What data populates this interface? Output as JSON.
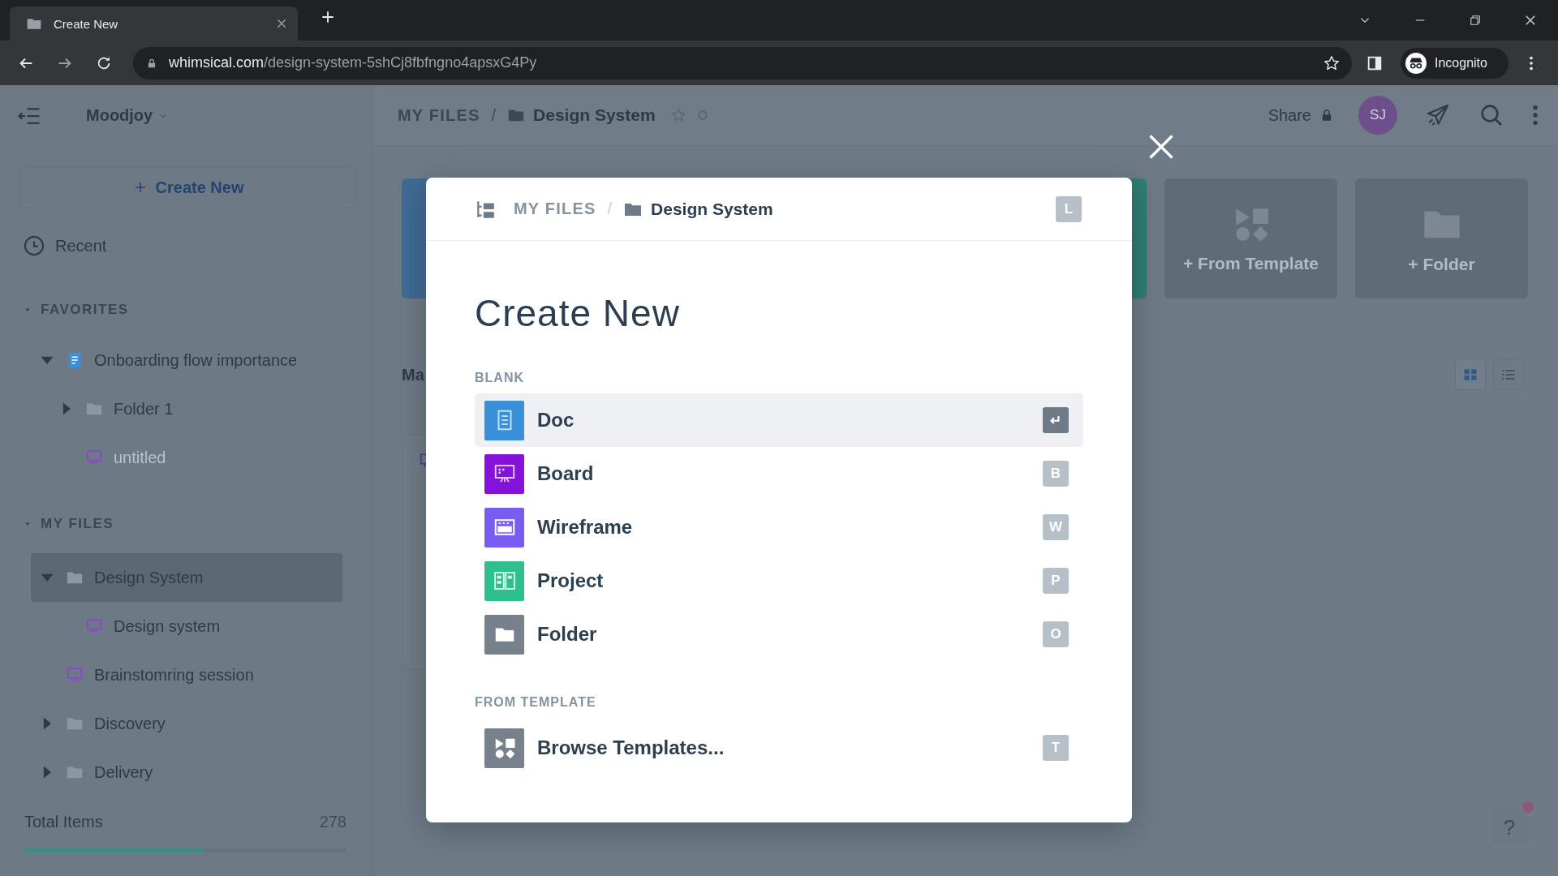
{
  "browser": {
    "tab_title": "Create New",
    "url_host": "whimsical.com",
    "url_path": "/design-system-5shCj8fbfngno4apsxG4Py",
    "profile_label": "Incognito"
  },
  "sidebar": {
    "workspace": "Moodjoy",
    "create_label": "Create New",
    "recent_label": "Recent",
    "sections": [
      {
        "title": "FAVORITES",
        "expanded": true,
        "items": [
          {
            "kind": "doc",
            "label": "Onboarding flow importance",
            "expandable": true,
            "expanded": true,
            "selected": false,
            "muted": false,
            "children": [
              {
                "kind": "folder",
                "label": "Folder 1",
                "expandable": true,
                "expanded": false,
                "selected": false,
                "muted": false
              },
              {
                "kind": "board",
                "label": "untitled",
                "expandable": false,
                "selected": false,
                "muted": true
              }
            ]
          }
        ]
      },
      {
        "title": "MY FILES",
        "expanded": true,
        "items": [
          {
            "kind": "folder",
            "label": "Design System",
            "expandable": true,
            "expanded": true,
            "selected": true,
            "muted": false,
            "children": [
              {
                "kind": "board",
                "label": "Design system",
                "expandable": false,
                "selected": false,
                "muted": false
              }
            ]
          },
          {
            "kind": "board",
            "label": "Brainstomring session",
            "expandable": false,
            "selected": false,
            "muted": false
          },
          {
            "kind": "folder",
            "label": "Discovery",
            "expandable": true,
            "expanded": false,
            "selected": false,
            "muted": false
          },
          {
            "kind": "folder",
            "label": "Delivery",
            "expandable": true,
            "expanded": false,
            "selected": false,
            "muted": false
          }
        ]
      }
    ],
    "total": {
      "label": "Total Items",
      "count": "278",
      "level": 0.56
    }
  },
  "header": {
    "breadcrumb": [
      {
        "kind": "root",
        "label": "MY FILES"
      },
      {
        "kind": "folder",
        "label": "Design System"
      }
    ],
    "breadcrumb_separator": "/",
    "share_label": "Share",
    "avatar": "SJ"
  },
  "main": {
    "tiles": [
      {
        "color": "#3f6b96"
      },
      {
        "color": "#2f7d73"
      }
    ],
    "create_cards": [
      {
        "kind": "template",
        "label": "+ From Template"
      },
      {
        "kind": "folder",
        "label": "+ Folder"
      }
    ],
    "section_label": "Ma",
    "view_modes": [
      {
        "kind": "grid",
        "selected": true
      },
      {
        "kind": "list",
        "selected": false
      }
    ],
    "help": {
      "label": "?",
      "notification": true
    }
  },
  "modal": {
    "breadcrumb": [
      {
        "kind": "root",
        "label": "MY FILES"
      },
      {
        "kind": "folder",
        "label": "Design System"
      }
    ],
    "breadcrumb_separator": "/",
    "breadcrumb_key": "L",
    "title": "Create New",
    "groups": [
      {
        "label": "BLANK",
        "items": [
          {
            "kind": "doc",
            "label": "Doc",
            "key": "↵",
            "selected": true
          },
          {
            "kind": "board",
            "label": "Board",
            "key": "B",
            "selected": false
          },
          {
            "kind": "wireframe",
            "label": "Wireframe",
            "key": "W",
            "selected": false
          },
          {
            "kind": "project",
            "label": "Project",
            "key": "P",
            "selected": false
          },
          {
            "kind": "folder",
            "label": "Folder",
            "key": "O",
            "selected": false
          }
        ]
      },
      {
        "label": "FROM TEMPLATE",
        "items": [
          {
            "kind": "template",
            "label": "Browse Templates...",
            "key": "T",
            "selected": false
          }
        ]
      }
    ]
  }
}
